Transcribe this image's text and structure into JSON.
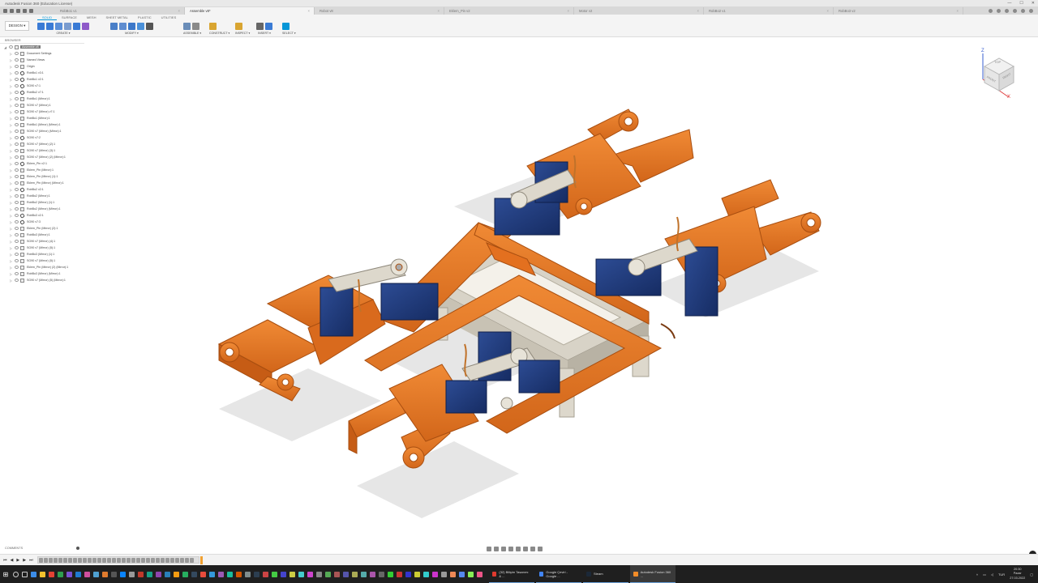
{
  "window": {
    "title": "Autodesk Fusion 360 (Education License)",
    "controls": [
      "—",
      "☐",
      "✕"
    ]
  },
  "tabs": [
    {
      "label": "RobBo1 v1",
      "active": false
    },
    {
      "label": "Assemble v8*",
      "active": true
    },
    {
      "label": "Robot v8",
      "active": false
    },
    {
      "label": "Eklem_Pin v2",
      "active": false
    },
    {
      "label": "Motor v2",
      "active": false
    },
    {
      "label": "RobBo2 v1",
      "active": false
    },
    {
      "label": "RobBo3 v2",
      "active": false
    }
  ],
  "toolbar": {
    "workspace": "DESIGN ▾",
    "mode_tabs": [
      "SOLID",
      "SURFACE",
      "MESH",
      "SHEET METAL",
      "PLASTIC",
      "UTILITIES"
    ],
    "active_mode": "SOLID",
    "groups": [
      {
        "label": "CREATE ▾",
        "colors": [
          "#3a7bd5",
          "#3a7bd5",
          "#5a8fd8",
          "#7a9ccf",
          "#3a7bd5",
          "#8e5ac9"
        ]
      },
      {
        "label": "MODIFY ▾",
        "colors": [
          "#4a7fc8",
          "#5f8dd0",
          "#3c78c9",
          "#4a90d9",
          "#555555"
        ]
      },
      {
        "label": "ASSEMBLE ▾",
        "colors": [
          "#6a8db8",
          "#8a8a8a"
        ]
      },
      {
        "label": "CONSTRUCT ▾",
        "colors": [
          "#d9a531"
        ]
      },
      {
        "label": "INSPECT ▾",
        "colors": [
          "#d9a531"
        ]
      },
      {
        "label": "INSERT ▾",
        "colors": [
          "#666666",
          "#3a7bd5"
        ]
      },
      {
        "label": "SELECT ▾",
        "colors": [
          "#0696d7"
        ]
      }
    ]
  },
  "browser": {
    "header": "BROWSER",
    "root": "Assemble v8",
    "items": [
      {
        "label": "Document Settings",
        "icon": "gear-icon"
      },
      {
        "label": "Named Views",
        "icon": "folder-icon"
      },
      {
        "label": "Origin",
        "icon": "folder-icon"
      },
      {
        "label": "RobBo1 v3:1",
        "icon": "link-icon"
      },
      {
        "label": "RobBo1 v2:1",
        "icon": "link-icon"
      },
      {
        "label": "SG90 v7:1",
        "icon": "link-icon"
      },
      {
        "label": "RobBo2 v7:1",
        "icon": "link-icon"
      },
      {
        "label": "RobBo1 (Mirror):1",
        "icon": "box-icon"
      },
      {
        "label": "SG90 v7 (Mirror):1",
        "icon": "box-icon"
      },
      {
        "label": "SG90 v7 (Mirror) v7:1",
        "icon": "box-icon"
      },
      {
        "label": "RobBo1 (Mirror):1",
        "icon": "box-icon"
      },
      {
        "label": "RobBo1 (Mirror) (Mirror):1",
        "icon": "box-icon"
      },
      {
        "label": "SG90 v7 (Mirror) (Mirror):1",
        "icon": "box-icon"
      },
      {
        "label": "SG90 v7:2",
        "icon": "link-icon"
      },
      {
        "label": "SG90 v7 (Mirror) (2):1",
        "icon": "box-icon"
      },
      {
        "label": "SG90 v7 (Mirror) (3):1",
        "icon": "box-icon"
      },
      {
        "label": "SG90 v7 (Mirror) (2) (Mirror):1",
        "icon": "box-icon"
      },
      {
        "label": "Eklem_Pin v2:1",
        "icon": "link-icon"
      },
      {
        "label": "Eklem_Pin (Mirror):1",
        "icon": "box-icon"
      },
      {
        "label": "Eklem_Pin (Mirror) (1):1",
        "icon": "box-icon"
      },
      {
        "label": "Eklem_Pin (Mirror) (Mirror):1",
        "icon": "box-icon"
      },
      {
        "label": "RobBo2 v2:1",
        "icon": "link-icon"
      },
      {
        "label": "RobBo2 (Mirror):1",
        "icon": "box-icon"
      },
      {
        "label": "RobBo2 (Mirror) (1):1",
        "icon": "box-icon"
      },
      {
        "label": "RobBo2 (Mirror) (Mirror):1",
        "icon": "box-icon"
      },
      {
        "label": "RobBo3 v2:1",
        "icon": "link-icon"
      },
      {
        "label": "SG90 v7:3",
        "icon": "link-icon"
      },
      {
        "label": "Eklem_Pin (Mirror) (2):1",
        "icon": "box-icon"
      },
      {
        "label": "RobBo3 (Mirror):1",
        "icon": "box-icon"
      },
      {
        "label": "SG90 v7 (Mirror) (4):1",
        "icon": "box-icon"
      },
      {
        "label": "SG90 v7 (Mirror) (5):1",
        "icon": "box-icon"
      },
      {
        "label": "RobBo3 (Mirror) (1):1",
        "icon": "box-icon"
      },
      {
        "label": "SG90 v7 (Mirror) (5):1",
        "icon": "box-icon"
      },
      {
        "label": "Eklem_Pin (Mirror) (2) (Mirror):1",
        "icon": "box-icon"
      },
      {
        "label": "RobBo3 (Mirror) (Mirror):1",
        "icon": "box-icon"
      },
      {
        "label": "SG90 v7 (Mirror) (5) (Mirror):1",
        "icon": "box-icon"
      }
    ]
  },
  "viewcube": {
    "faces": [
      "TOP",
      "FRONT",
      "RIGHT"
    ],
    "axes": [
      "Z",
      "X"
    ]
  },
  "comments": {
    "label": "COMMENTS"
  },
  "colors": {
    "accent": "#0696d7",
    "part_orange": "#e87722",
    "servo_blue": "#1f3a7a",
    "frame_beige": "#ddd8cc"
  },
  "taskbar": {
    "apps": [
      {
        "label": "(32) Bilişim Tasarımı & ...",
        "color": "#e03a2f",
        "active": false
      },
      {
        "label": "Google Çeviri - Google ...",
        "color": "#4285f4",
        "active": false
      },
      {
        "label": "Steam",
        "color": "#1b2838",
        "active": false
      },
      {
        "label": "Autodesk Fusion 360 ...",
        "color": "#f28c28",
        "active": true
      }
    ],
    "lang": "TUR",
    "time": "20:30",
    "day": "Pazar",
    "date": "27.03.2022"
  }
}
